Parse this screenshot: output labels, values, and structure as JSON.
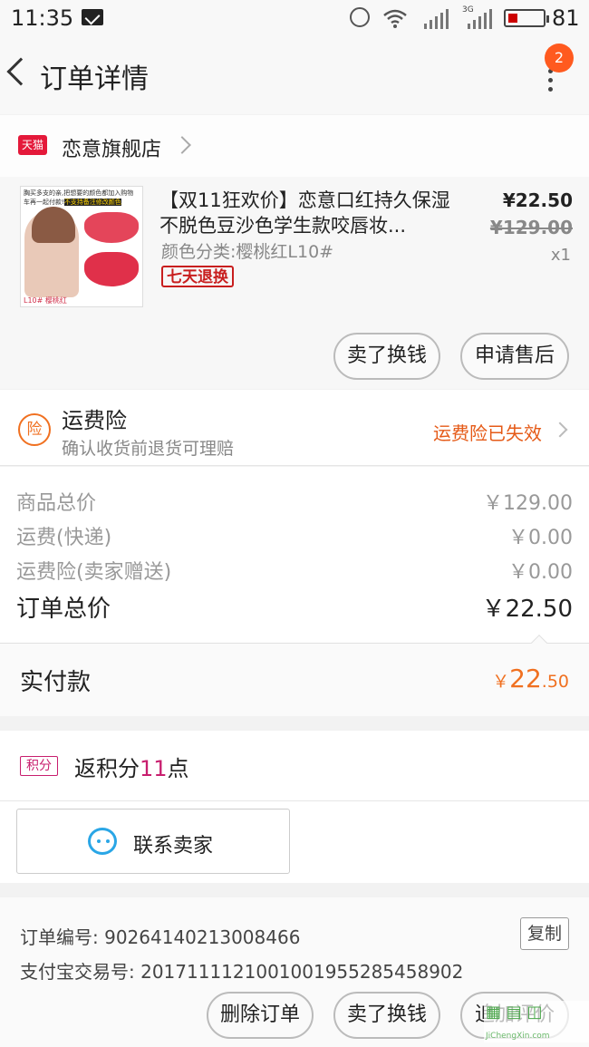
{
  "status_bar": {
    "time": "11:35",
    "battery_level": "81"
  },
  "header": {
    "title": "订单详情",
    "badge_count": "2"
  },
  "shop": {
    "name": "恋意旗舰店",
    "tmall_label": "天猫"
  },
  "product": {
    "thumbnail": {
      "top_text_1": "胸买多支的亲,把想要的颜色都加入购物",
      "top_text_2": "车再一起付款!",
      "top_highlight": "不支持备注修改颜色",
      "bottom_text": "L10# 樱桃红"
    },
    "title": "【双11狂欢价】恋意口红持久保湿不脱色豆沙色学生款咬唇妆...",
    "variant": "颜色分类:樱桃红L10#",
    "tag": "七天退换",
    "price": "¥22.50",
    "original_price": "¥129.00",
    "quantity": "x1"
  },
  "item_actions": {
    "sell_label": "卖了换钱",
    "after_sale_label": "申请售后"
  },
  "insurance": {
    "icon_label": "险",
    "title": "运费险",
    "subtitle": "确认收货前退货可理赔",
    "status": "运费险已失效"
  },
  "summary": {
    "goods_label": "商品总价",
    "goods_value": "￥129.00",
    "shipping_label": "运费(快递)",
    "shipping_value": "￥0.00",
    "insurance_label": "运费险(卖家赠送)",
    "insurance_value": "￥0.00",
    "total_label": "订单总价",
    "total_value": "￥22.50"
  },
  "paid": {
    "label": "实付款",
    "symbol": "￥",
    "integer": "22",
    "decimal": ".50"
  },
  "points": {
    "badge": "积分",
    "text_prefix": "返积分",
    "count": "11",
    "text_suffix": "点"
  },
  "contact": {
    "label": "联系卖家"
  },
  "order_info": {
    "order_number": "订单编号: 90264140213008466",
    "alipay_number": "支付宝交易号: 20171111210010019552854589​02",
    "copy_label": "复制"
  },
  "bottom_actions": {
    "delete_label": "删除订单",
    "sell_label": "卖了换钱",
    "review_label": "追加评价"
  },
  "watermark": {
    "text": "JiChengXin.com"
  },
  "colors": {
    "accent": "#f07020",
    "badge": "#ff5a1f",
    "tmall": "#e4193a",
    "points": "#c81e6e",
    "contact": "#2aa6e6"
  }
}
